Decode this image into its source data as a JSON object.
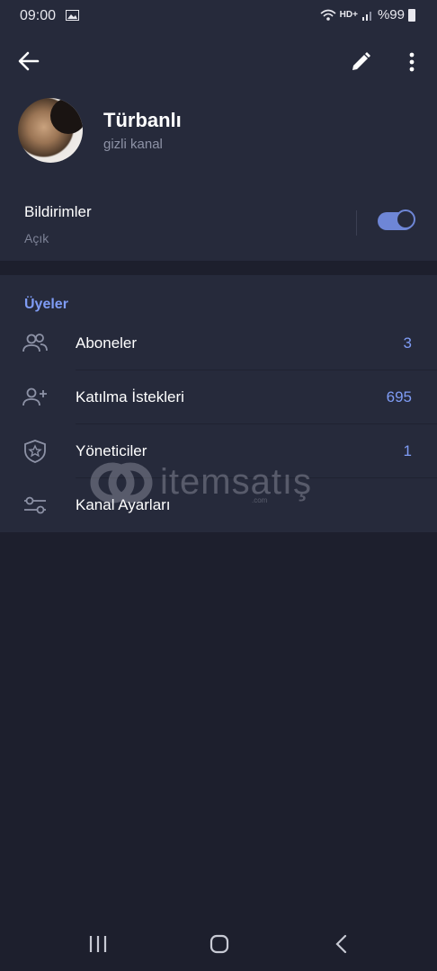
{
  "status_bar": {
    "time": "09:00",
    "network": "HD+",
    "battery": "%99",
    "icons": [
      "gallery-icon",
      "wifi-icon",
      "signal-icon",
      "battery-icon"
    ]
  },
  "header": {
    "icons": [
      "back-arrow-icon",
      "pencil-icon",
      "more-vert-icon"
    ],
    "channel_name": "Türbanlı",
    "channel_type": "gizli kanal"
  },
  "notifications": {
    "title": "Bildirimler",
    "status": "Açık",
    "enabled": true
  },
  "members": {
    "section_title": "Üyeler",
    "items": [
      {
        "label": "Aboneler",
        "value": "3",
        "icon": "people-icon"
      },
      {
        "label": "Katılma İstekleri",
        "value": "695",
        "icon": "add-person-icon"
      },
      {
        "label": "Yöneticiler",
        "value": "1",
        "icon": "admin-shield-icon"
      },
      {
        "label": "Kanal Ayarları",
        "value": "",
        "icon": "settings-sliders-icon"
      }
    ]
  },
  "watermark": {
    "text": "itemsatış",
    "subtext": ".com"
  },
  "navigation_bar": {
    "icons": [
      "recent-apps-icon",
      "home-icon",
      "back-nav-icon"
    ]
  },
  "colors": {
    "background": "#1d1f2d",
    "surface": "#262a3b",
    "accent": "#7f9cf5",
    "toggle": "#6e86d6",
    "secondary_text": "#8d92a6"
  }
}
